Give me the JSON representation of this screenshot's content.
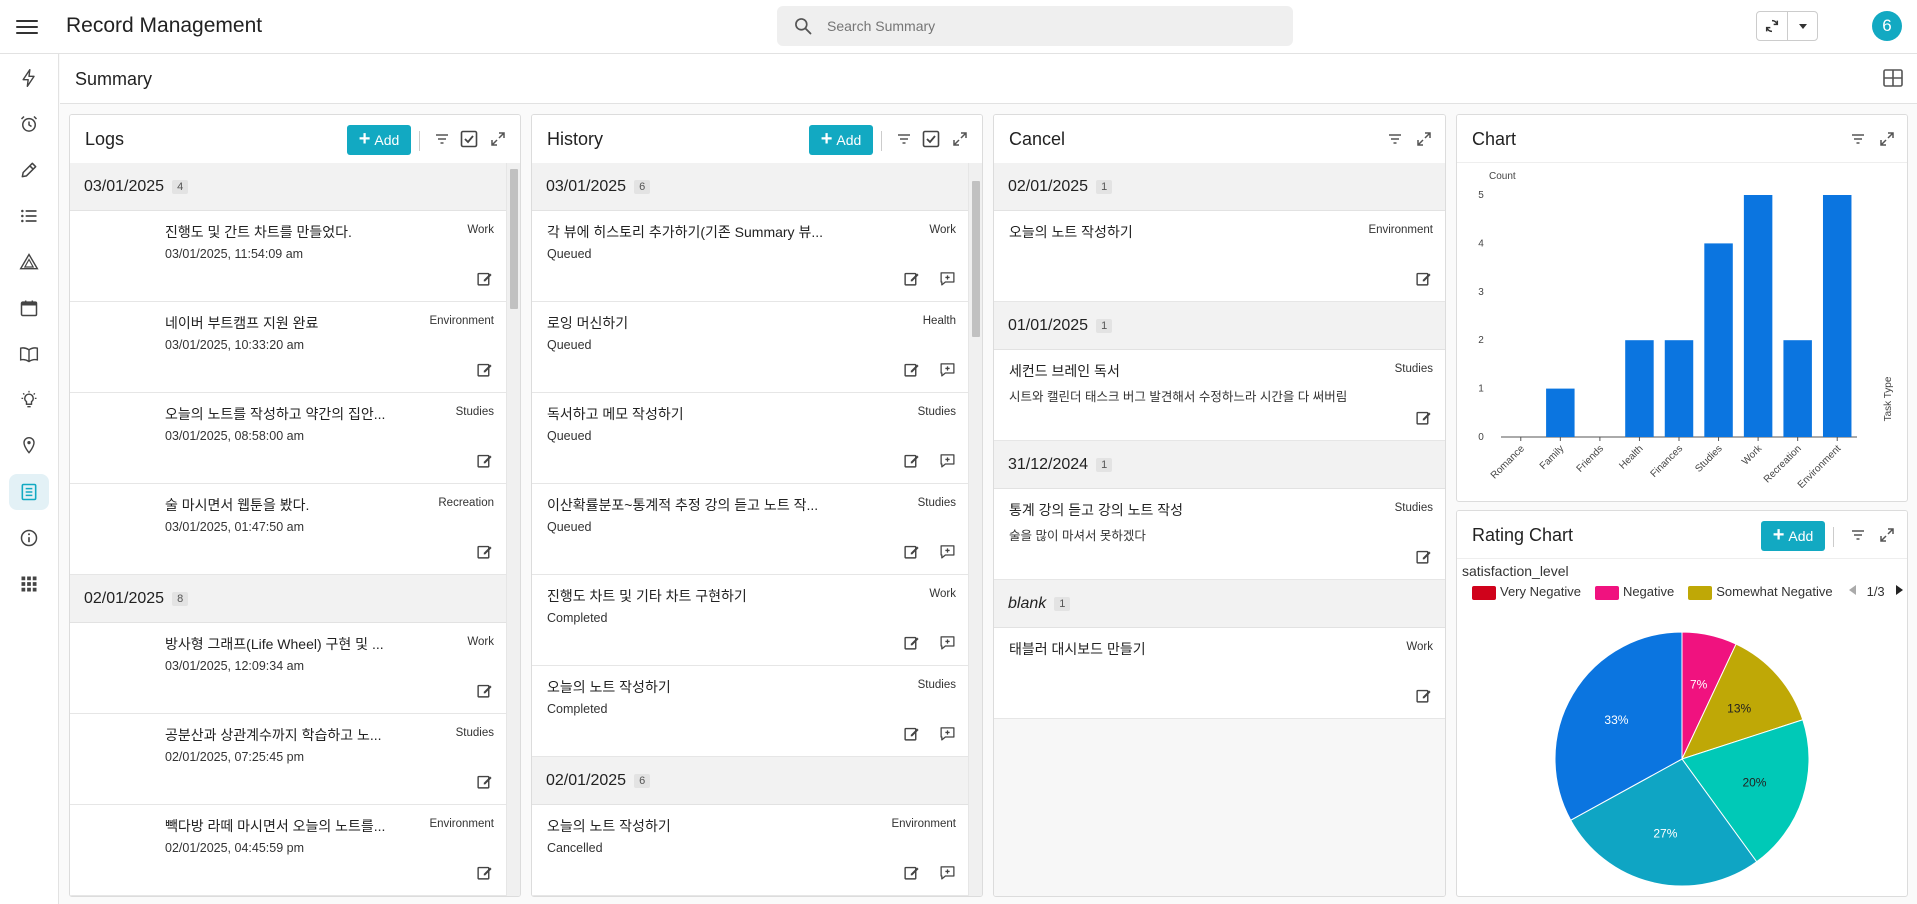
{
  "app": {
    "title": "Record Management",
    "avatar_letter": "6"
  },
  "search": {
    "placeholder": "Search Summary"
  },
  "page": {
    "title": "Summary"
  },
  "sidebar": {
    "items": [
      "flash-icon",
      "alarm-icon",
      "pencil-icon",
      "list-icon",
      "triangle-rule-icon",
      "calendar-icon",
      "book-icon",
      "lightbulb-icon",
      "location-bulb-icon",
      "record-list-icon",
      "info-icon",
      "apps-grid-icon"
    ],
    "active_index": 9
  },
  "logs": {
    "title": "Logs",
    "add_label": "Add",
    "groups": [
      {
        "date": "03/01/2025",
        "count": "4",
        "rows": [
          {
            "title": "진행도 및 간트 차트를 만들었다.",
            "sub": "03/01/2025, 11:54:09 am",
            "tag": "Work"
          },
          {
            "title": "네이버 부트캠프 지원 완료",
            "sub": "03/01/2025, 10:33:20 am",
            "tag": "Environment"
          },
          {
            "title": "오늘의 노트를 작성하고 약간의 집안...",
            "sub": "03/01/2025, 08:58:00 am",
            "tag": "Studies"
          },
          {
            "title": "술 마시면서 웹툰을 봤다.",
            "sub": "03/01/2025, 01:47:50 am",
            "tag": "Recreation"
          }
        ]
      },
      {
        "date": "02/01/2025",
        "count": "8",
        "rows": [
          {
            "title": "방사형 그래프(Life Wheel) 구현 및 ...",
            "sub": "03/01/2025, 12:09:34 am",
            "tag": "Work"
          },
          {
            "title": "공분산과 상관계수까지 학습하고 노...",
            "sub": "02/01/2025, 07:25:45 pm",
            "tag": "Studies"
          },
          {
            "title": "빽다방 라떼 마시면서 오늘의 노트를...",
            "sub": "02/01/2025, 04:45:59 pm",
            "tag": "Environment"
          }
        ]
      }
    ]
  },
  "history": {
    "title": "History",
    "add_label": "Add",
    "groups": [
      {
        "date": "03/01/2025",
        "count": "6",
        "rows": [
          {
            "title": "각 뷰에 히스토리 추가하기(기존 Summary 뷰...",
            "sub": "Queued",
            "tag": "Work"
          },
          {
            "title": "로잉 머신하기",
            "sub": "Queued",
            "tag": "Health"
          },
          {
            "title": "독서하고 메모 작성하기",
            "sub": "Queued",
            "tag": "Studies"
          },
          {
            "title": "이산확률분포~통계적 추정 강의 듣고 노트 작...",
            "sub": "Queued",
            "tag": "Studies"
          },
          {
            "title": "진행도 차트 및 기타 차트 구현하기",
            "sub": "Completed",
            "tag": "Work"
          },
          {
            "title": "오늘의 노트 작성하기",
            "sub": "Completed",
            "tag": "Studies"
          }
        ]
      },
      {
        "date": "02/01/2025",
        "count": "6",
        "rows": [
          {
            "title": "오늘의 노트 작성하기",
            "sub": "Cancelled",
            "tag": "Environment"
          }
        ]
      }
    ]
  },
  "cancel": {
    "title": "Cancel",
    "groups": [
      {
        "date": "02/01/2025",
        "count": "1",
        "italic": false,
        "rows": [
          {
            "title": "오늘의 노트 작성하기",
            "sub": "",
            "tag": "Environment"
          }
        ]
      },
      {
        "date": "01/01/2025",
        "count": "1",
        "italic": false,
        "rows": [
          {
            "title": "세컨드 브레인 독서",
            "sub": "시트와 캘린더 태스크 버그 발견해서 수정하느라 시간을 다 써버림",
            "tag": "Studies"
          }
        ]
      },
      {
        "date": "31/12/2024",
        "count": "1",
        "italic": false,
        "rows": [
          {
            "title": "통계 강의 듣고 강의 노트 작성",
            "sub": "술을 많이 마셔서 못하겠다",
            "tag": "Studies"
          }
        ]
      },
      {
        "date": "blank",
        "count": "1",
        "italic": true,
        "rows": [
          {
            "title": "태블러 대시보드 만들기",
            "sub": "",
            "tag": "Work"
          }
        ]
      }
    ]
  },
  "chart": {
    "title": "Chart",
    "chart_data": {
      "type": "bar",
      "categories": [
        "Romance",
        "Family",
        "Friends",
        "Health",
        "Finances",
        "Studies",
        "Work",
        "Recreation",
        "Environment"
      ],
      "values": [
        0,
        1,
        0,
        2,
        2,
        4,
        5,
        2,
        5
      ],
      "ylabel": "Count",
      "xlabel": "Task Type",
      "ylim": [
        0,
        5
      ],
      "yticks": [
        0,
        1,
        2,
        3,
        4,
        5
      ],
      "color": "#0b75e0"
    }
  },
  "rating": {
    "title": "Rating Chart",
    "add_label": "Add",
    "subtitle": "satisfaction_level",
    "legend_page": "1/3",
    "legend": [
      {
        "name": "Very Negative",
        "color": "#d0021b"
      },
      {
        "name": "Negative",
        "color": "#f0127f"
      },
      {
        "name": "Somewhat Negative",
        "color": "#bfa806"
      }
    ],
    "chart_data": {
      "type": "pie",
      "slices": [
        {
          "label": "7%",
          "value": 7,
          "color": "#f0127f"
        },
        {
          "label": "13%",
          "value": 13,
          "color": "#bfa806"
        },
        {
          "label": "20%",
          "value": 20,
          "color": "#00c9b7"
        },
        {
          "label": "27%",
          "value": 27,
          "color": "#0fa5c4"
        },
        {
          "label": "33%",
          "value": 33,
          "color": "#0b75e0"
        }
      ]
    }
  }
}
